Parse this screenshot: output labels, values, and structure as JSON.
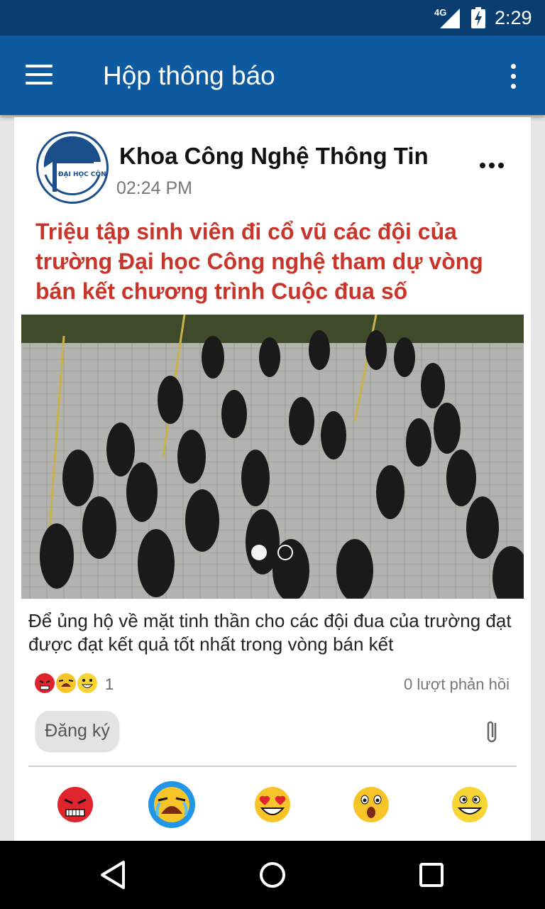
{
  "status_bar": {
    "network": "4G",
    "time": "2:29"
  },
  "app_bar": {
    "title": "Hộp thông báo"
  },
  "post": {
    "sender": "Khoa Công Nghệ Thông Tin",
    "time": "02:24 PM",
    "logo_text": "ĐẠI HỌC CÔNG NGHỆ",
    "headline": "Triệu tập sinh viên đi cổ vũ các đội của trường Đại học Công nghệ tham dự vòng bán kết chương trình Cuộc đua số",
    "body": "Để ủng hộ về mặt tinh thần cho các đội đua của trường đạt được đạt kết quả tốt nhất trong vòng bán kết",
    "reaction_summary": {
      "icons": [
        "angry-emoji",
        "crying-emoji",
        "laughing-emoji"
      ],
      "count": "1"
    },
    "replies": "0 lượt phản hồi",
    "subscribe_label": "Đăng ký",
    "image_carousel": {
      "pages": 2,
      "active": 0
    }
  },
  "reaction_bar": [
    {
      "name": "angry-emoji",
      "selected": false
    },
    {
      "name": "crying-emoji",
      "selected": true
    },
    {
      "name": "heart-eyes-emoji",
      "selected": false
    },
    {
      "name": "surprised-emoji",
      "selected": false
    },
    {
      "name": "laughing-emoji",
      "selected": false
    }
  ],
  "colors": {
    "status_bar": "#0a3d70",
    "app_bar": "#0d5aa0",
    "headline": "#c8352b",
    "selected_reaction": "#2196e8"
  }
}
